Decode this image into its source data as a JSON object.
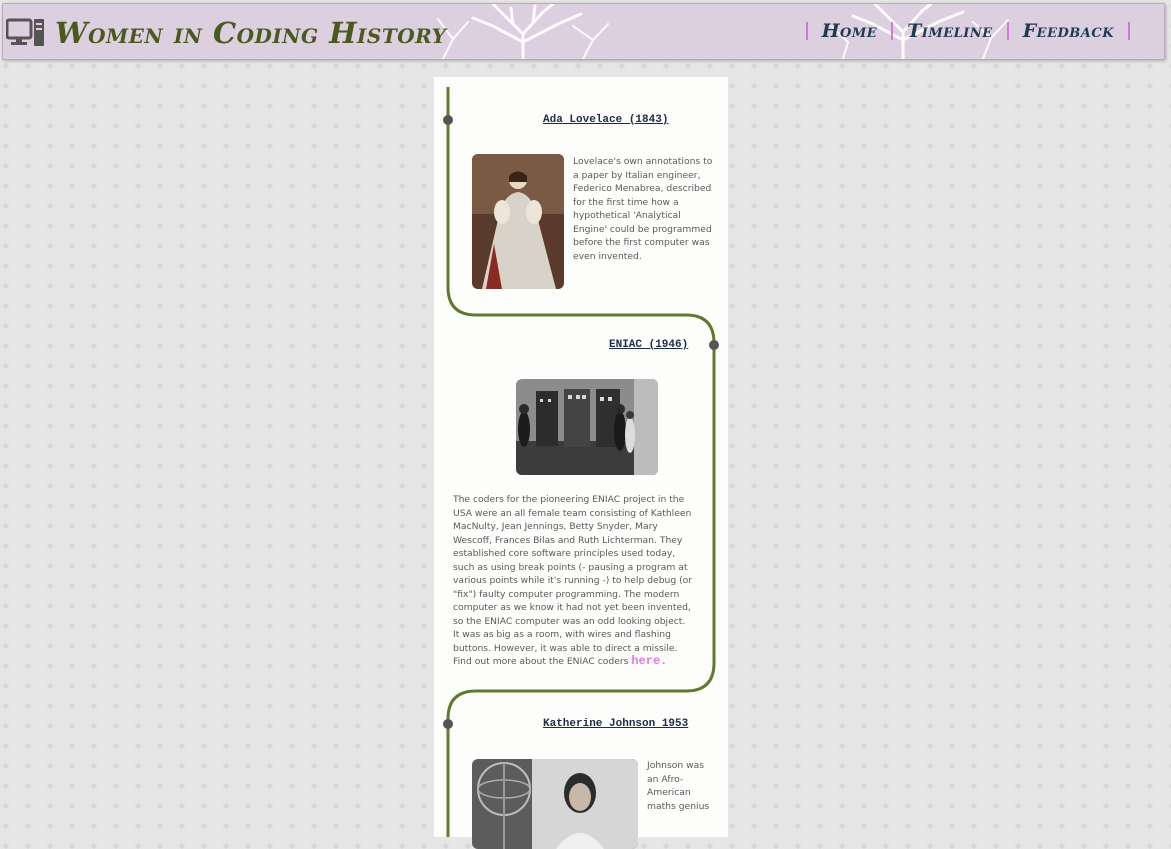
{
  "header": {
    "title": "Women in Coding History",
    "nav": [
      "Home",
      "Timeline",
      "Feedback"
    ],
    "colors": {
      "bar": "#dccfe0",
      "title": "#4a5a1e",
      "nav": "#203a52",
      "separator": "#d07ad0"
    }
  },
  "timeline": {
    "line_color": "#5e7a2c",
    "entries": [
      {
        "title": "Ada Lovelace (1843)",
        "photo": "ada-lovelace-portrait",
        "text": "Lovelace's own annotations to a paper by Italian engineer, Federico Menabrea, described for the first time how a hypothetical 'Analytical Engine' could be programmed before the first computer was even invented."
      },
      {
        "title": "ENIAC (1946)",
        "photo": "eniac-coders-photo",
        "text": "The coders for the pioneering ENIAC project in the USA were an all female team consisting of Kathleen MacNulty, Jean Jennings, Betty Snyder, Mary Wescoff, Frances Bilas and Ruth Lichterman. They established core software principles used today, such as using break points (- pausing a program at various points while it's running -) to help debug (or \"fix\") faulty computer programming. The modern computer as we know it had not yet been invented, so the ENIAC computer was an odd looking object. It was as big as a room, with wires and flashing buttons. However, it was able to direct a missile. Find out more about the ENIAC coders",
        "link": "here."
      },
      {
        "title": "Katherine Johnson 1953",
        "photo": "katherine-johnson-photo",
        "text": "Johnson was an Afro-American maths genius"
      }
    ]
  }
}
